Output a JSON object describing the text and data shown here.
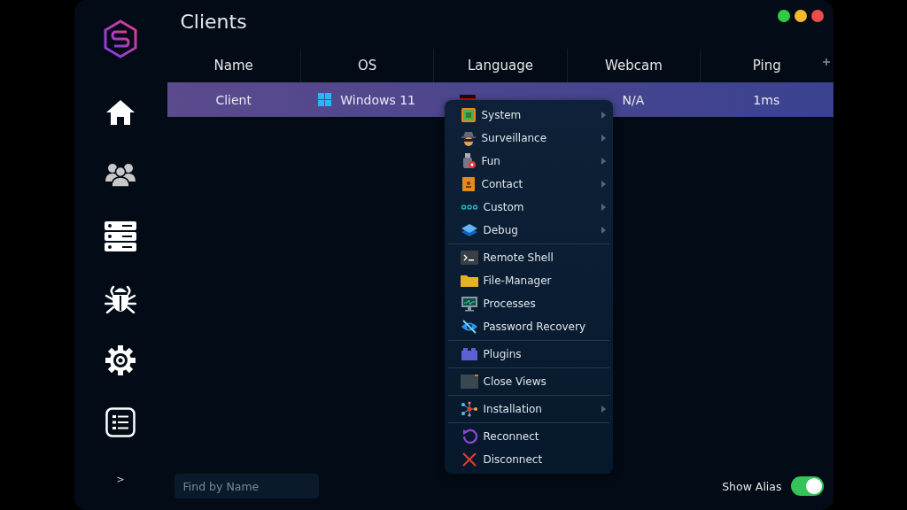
{
  "window": {
    "title": "Clients"
  },
  "sidebar": {
    "items": [
      {
        "selected": false
      },
      {
        "selected": false
      },
      {
        "selected": false
      },
      {
        "selected": false
      },
      {
        "selected": false
      },
      {
        "selected": false
      }
    ],
    "expand": ">"
  },
  "table": {
    "columns": [
      "Name",
      "OS",
      "Language",
      "Webcam",
      "Ping"
    ],
    "rows": [
      {
        "selected": true,
        "name": "Client",
        "os": "Windows 11",
        "webcam": "N/A",
        "ping": "1ms"
      }
    ]
  },
  "context_menu": {
    "groups": [
      {
        "items": [
          {
            "label": "System",
            "submenu": true
          },
          {
            "label": "Surveillance",
            "submenu": true
          },
          {
            "label": "Fun",
            "submenu": true
          },
          {
            "label": "Contact",
            "submenu": true
          },
          {
            "label": "Custom",
            "submenu": true
          },
          {
            "label": "Debug",
            "submenu": true
          }
        ]
      },
      {
        "items": [
          {
            "label": "Remote Shell",
            "submenu": false
          },
          {
            "label": "File-Manager",
            "submenu": false
          },
          {
            "label": "Processes",
            "submenu": false
          },
          {
            "label": "Password Recovery",
            "submenu": false
          }
        ]
      },
      {
        "items": [
          {
            "label": "Plugins",
            "submenu": false
          }
        ]
      },
      {
        "items": [
          {
            "label": "Close Views",
            "submenu": false
          }
        ]
      },
      {
        "items": [
          {
            "label": "Installation",
            "submenu": true
          }
        ]
      },
      {
        "items": [
          {
            "label": "Reconnect",
            "submenu": false
          },
          {
            "label": "Disconnect",
            "submenu": false
          }
        ]
      }
    ]
  },
  "search": {
    "placeholder": "Find by Name"
  },
  "show_alias": {
    "label": "Show Alias",
    "on": true
  }
}
